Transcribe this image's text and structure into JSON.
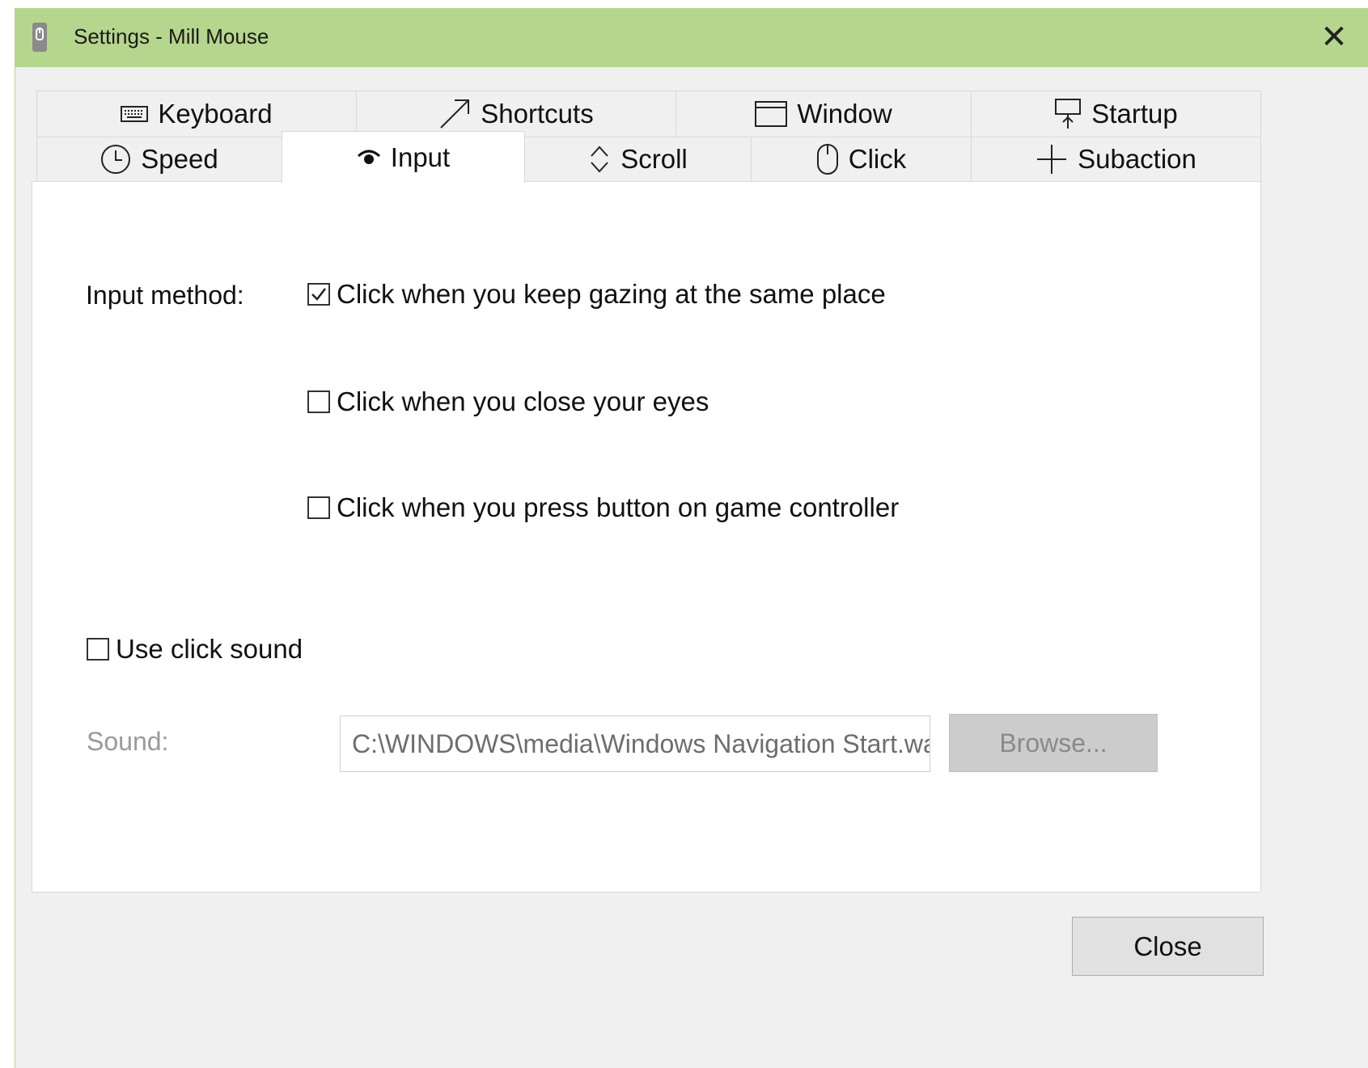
{
  "window": {
    "title": "Settings - Mill Mouse",
    "close_glyph": "✕",
    "titlebar_color": "#b5d68d"
  },
  "tabs_back_row": [
    {
      "label": "Keyboard",
      "icon": "keyboard-icon"
    },
    {
      "label": "Shortcuts",
      "icon": "arrow-up-right-icon"
    },
    {
      "label": "Window",
      "icon": "window-icon"
    },
    {
      "label": "Startup",
      "icon": "startup-icon"
    }
  ],
  "tabs_front_row": [
    {
      "label": "Speed",
      "icon": "clock-icon"
    },
    {
      "label": "Input",
      "icon": "eye-icon",
      "active": true
    },
    {
      "label": "Scroll",
      "icon": "scroll-icon"
    },
    {
      "label": "Click",
      "icon": "mouse-icon"
    },
    {
      "label": "Subaction",
      "icon": "plus-icon"
    }
  ],
  "input_page": {
    "input_method_label": "Input method:",
    "options": [
      {
        "label": "Click when you keep gazing at the same place",
        "checked": true
      },
      {
        "label": "Click when you close your eyes",
        "checked": false
      },
      {
        "label": "Click when you press button on game controller",
        "checked": false
      }
    ],
    "click_sound": {
      "label": "Use click sound",
      "checked": false
    },
    "sound_label": "Sound:",
    "sound_path": "C:\\WINDOWS\\media\\Windows Navigation Start.wav",
    "browse_label": "Browse..."
  },
  "footer": {
    "close_label": "Close"
  }
}
